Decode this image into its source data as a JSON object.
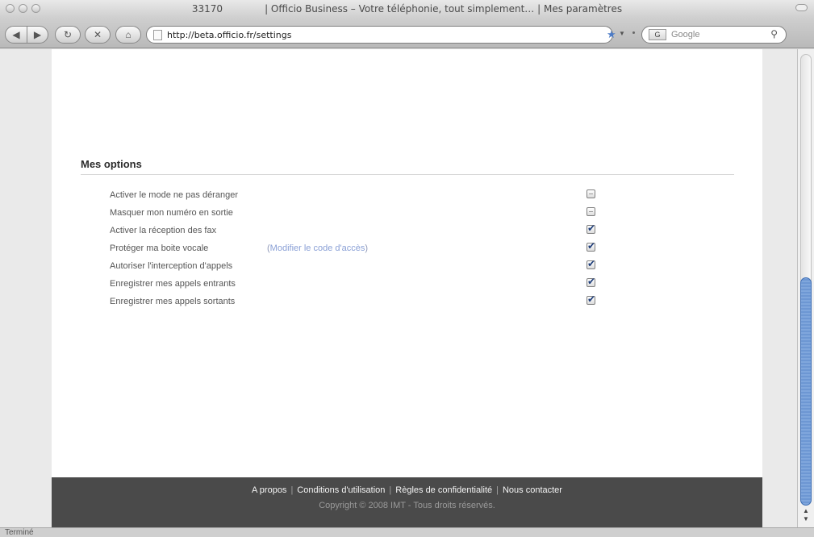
{
  "window": {
    "title_number": "33170",
    "title_text": "| Officio Business – Votre téléphonie, tout simplement… | Mes paramètres"
  },
  "toolbar": {
    "url": "http://beta.officio.fr/settings",
    "search_placeholder": "Google",
    "search_engine_badge": "G"
  },
  "section": {
    "title": "Mes options"
  },
  "options": [
    {
      "label": "Activer le mode ne pas déranger",
      "checked": false
    },
    {
      "label": "Masquer mon numéro en sortie",
      "checked": false
    },
    {
      "label": "Activer la réception des fax",
      "checked": true
    },
    {
      "label": "Protéger ma boite vocale",
      "checked": true,
      "link_text": "Modifier le code d'accès"
    },
    {
      "label": "Autoriser l'interception d'appels",
      "checked": true
    },
    {
      "label": "Enregistrer mes appels entrants",
      "checked": true
    },
    {
      "label": "Enregistrer mes appels sortants",
      "checked": true
    }
  ],
  "footer": {
    "links": [
      "A propos",
      "Conditions d'utilisation",
      "Règles de confidentialité",
      "Nous contacter"
    ],
    "copyright": "Copyright © 2008 IMT - Tous droits réservés."
  },
  "status": {
    "text": "Terminé"
  },
  "scrollbar": {
    "position_fraction": 1.0
  }
}
